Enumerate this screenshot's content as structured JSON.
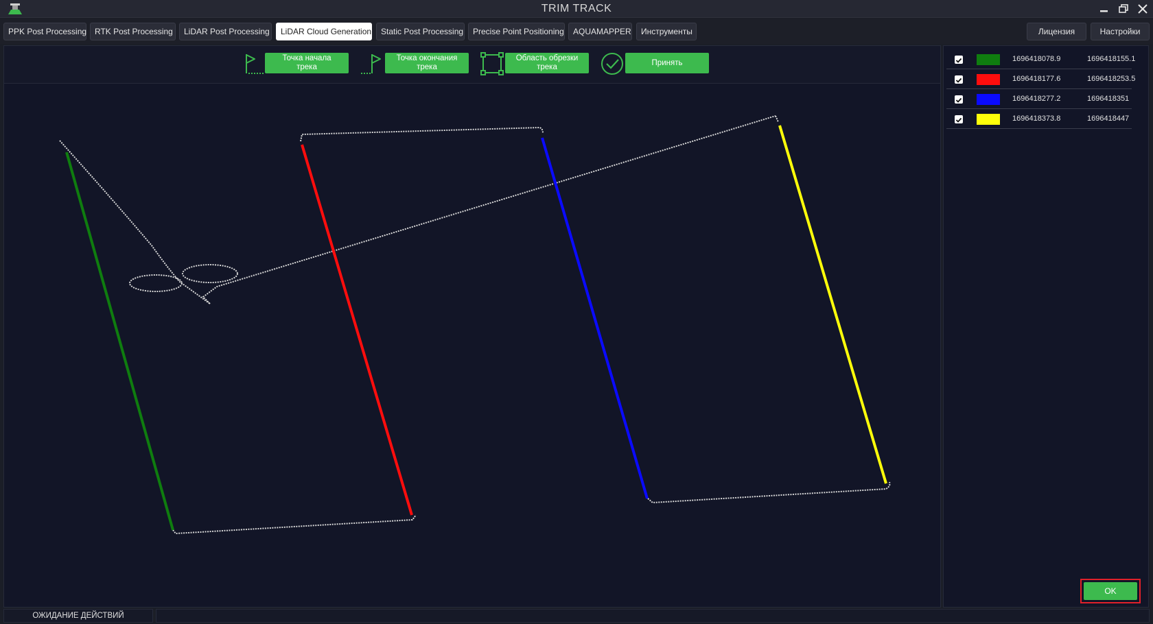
{
  "app": {
    "title": "TRIM TRACK"
  },
  "tabs": [
    {
      "label": "PPK Post Processing"
    },
    {
      "label": "RTK Post Processing"
    },
    {
      "label": "LiDAR Post Processing"
    },
    {
      "label": "LiDAR Cloud Generation",
      "active": true
    },
    {
      "label": "Static Post Processing"
    },
    {
      "label": "Precise Point Positioning"
    },
    {
      "label": "AQUAMAPPER"
    },
    {
      "label": "Инструменты"
    }
  ],
  "right_tabs": [
    {
      "label": "Лицензия"
    },
    {
      "label": "Настройки"
    }
  ],
  "toolbar": {
    "start_point": {
      "line1": "Точка начала",
      "line2": "трека",
      "icon": "flag-start-icon"
    },
    "end_point": {
      "line1": "Точка окончания",
      "line2": "трека",
      "icon": "flag-end-icon"
    },
    "crop_area": {
      "line1": "Область обрезки",
      "line2": "трека",
      "icon": "crop-area-icon"
    },
    "accept": {
      "label": "Принять",
      "icon": "check-circle-icon"
    }
  },
  "tracks": [
    {
      "checked": true,
      "color": "#0f7d0f",
      "start": "1696418078.9",
      "end": "1696418155.1"
    },
    {
      "checked": true,
      "color": "#ff0d0d",
      "start": "1696418177.6",
      "end": "1696418253.5"
    },
    {
      "checked": true,
      "color": "#0a0aff",
      "start": "1696418277.2",
      "end": "1696418351"
    },
    {
      "checked": true,
      "color": "#ffff0a",
      "start": "1696418373.8",
      "end": "1696418447"
    }
  ],
  "ok_button": {
    "label": "OK"
  },
  "status": {
    "text": "ОЖИДАНИЕ ДЕЙСТВИЙ"
  },
  "colors": {
    "accent_green": "#3dba4e",
    "highlight_red": "#e0202a",
    "track_path": "#d8d8d8",
    "canvas_bg": "#121527"
  }
}
